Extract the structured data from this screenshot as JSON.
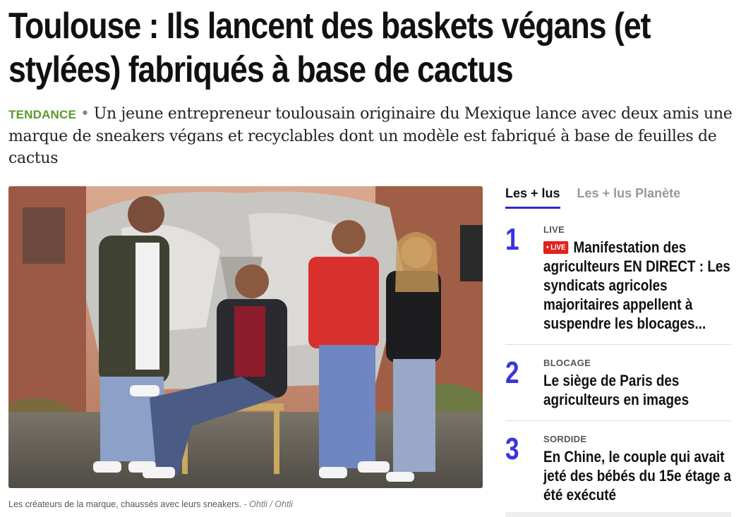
{
  "article": {
    "title": "Toulouse : Ils lancent des baskets végans (et stylées) fabriqués à base de cactus",
    "tag": "TENDANCE",
    "separator": "•",
    "lede": "Un jeune entrepreneur toulousain originaire du Mexique lance avec deux amis une marque de sneakers végans et recyclables dont un modèle est fabriqué à base de feuilles de cactus",
    "caption": "Les créateurs de la marque, chaussés avec leurs sneakers.",
    "credit": "- Ohtli  / Ohtli"
  },
  "sidebar": {
    "tabs": [
      "Les + lus",
      "Les + lus Planète"
    ],
    "items": [
      {
        "rank": "1",
        "kicker": "LIVE",
        "badge": "• LIVE",
        "title": "Manifestation des agriculteurs EN DIRECT : Les syndicats agricoles majoritaires appellent à suspendre les blocages..."
      },
      {
        "rank": "2",
        "kicker": "BLOCAGE",
        "title": "Le siège de Paris des agriculteurs en images"
      },
      {
        "rank": "3",
        "kicker": "SORDIDE",
        "title": "En Chine, le couple qui avait jeté des bébés du 15e étage a été exécuté"
      }
    ]
  },
  "colors": {
    "accent": "#3a33e0",
    "tag": "#5a9a2a",
    "live": "#e0231e"
  }
}
